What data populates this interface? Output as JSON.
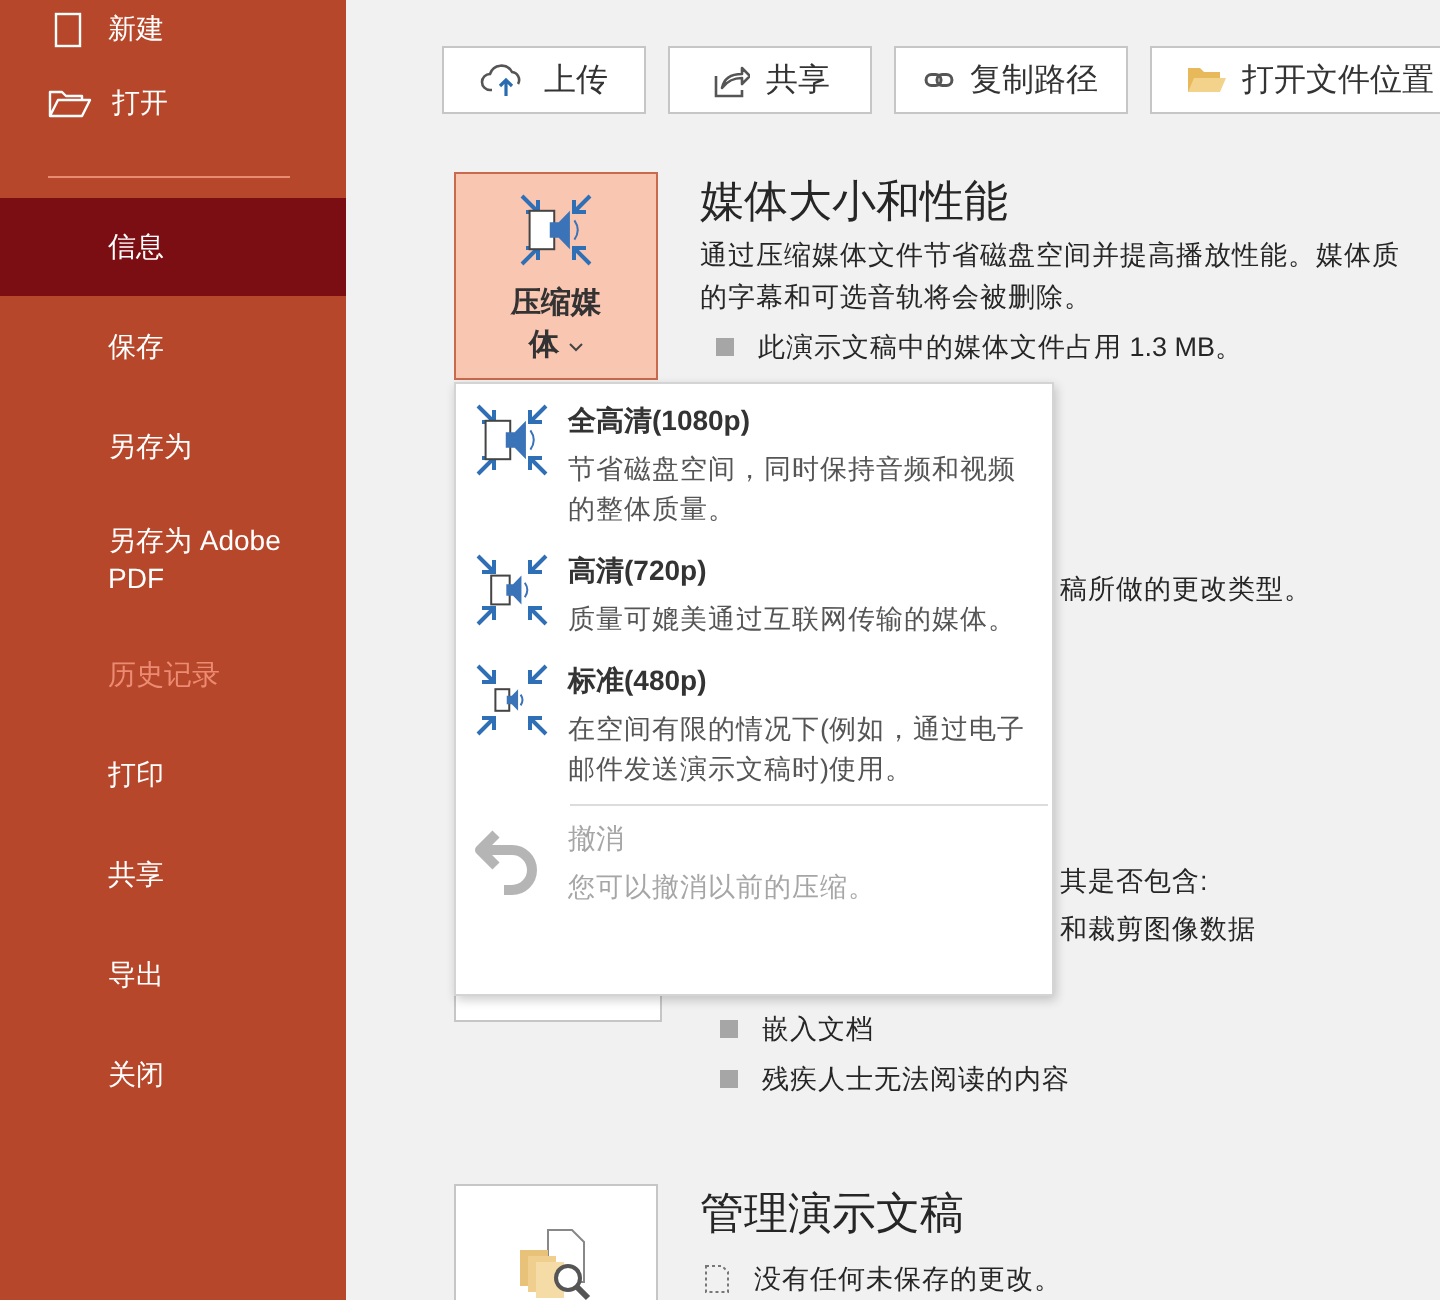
{
  "sidebar": {
    "top_items": [
      {
        "label": "新建",
        "kind": "new"
      },
      {
        "label": "打开",
        "kind": "open"
      }
    ],
    "items": [
      {
        "label": "信息",
        "selected": true,
        "disabled": false
      },
      {
        "label": "保存",
        "selected": false,
        "disabled": false
      },
      {
        "label": "另存为",
        "selected": false,
        "disabled": false
      },
      {
        "label": "另存为 Adobe PDF",
        "selected": false,
        "disabled": false
      },
      {
        "label": "历史记录",
        "selected": false,
        "disabled": true
      },
      {
        "label": "打印",
        "selected": false,
        "disabled": false
      },
      {
        "label": "共享",
        "selected": false,
        "disabled": false
      },
      {
        "label": "导出",
        "selected": false,
        "disabled": false
      },
      {
        "label": "关闭",
        "selected": false,
        "disabled": false
      }
    ]
  },
  "toolbar": {
    "buttons": [
      {
        "label": "上传",
        "kind": "upload"
      },
      {
        "label": "共享",
        "kind": "share"
      },
      {
        "label": "复制路径",
        "kind": "link"
      },
      {
        "label": "打开文件位置",
        "kind": "folder"
      }
    ]
  },
  "media_section": {
    "button_label": "压缩媒体",
    "heading": "媒体大小和性能",
    "description": [
      "通过压缩媒体文件节省磁盘空间并提高播放性能。媒体质",
      "的字幕和可选音轨将会被删除。"
    ],
    "bullets": [
      "此演示文稿中的媒体文件占用 1.3 MB。"
    ]
  },
  "compress_menu": {
    "items": [
      {
        "kind": "compress",
        "title": "全高清(1080p)",
        "description": "节省磁盘空间，同时保持音频和视频的整体质量。",
        "disabled": false
      },
      {
        "kind": "compress",
        "title": "高清(720p)",
        "description": "质量可媲美通过互联网传输的媒体。",
        "disabled": false
      },
      {
        "kind": "compress",
        "title": "标准(480p)",
        "description": "在空间有限的情况下(例如，通过电子邮件发送演示文稿时)使用。",
        "disabled": false
      },
      {
        "kind": "undo",
        "title": "撤消",
        "description": "您可以撤消以前的压缩。",
        "disabled": true
      }
    ]
  },
  "inspect_section": {
    "partial_lines": [
      "稿所做的更改类型。",
      "其是否包含:",
      "和裁剪图像数据"
    ],
    "bullets": [
      "嵌入文档",
      "残疾人士无法阅读的内容"
    ]
  },
  "manage_section": {
    "heading": "管理演示文稿",
    "status": "没有任何未保存的更改。"
  }
}
